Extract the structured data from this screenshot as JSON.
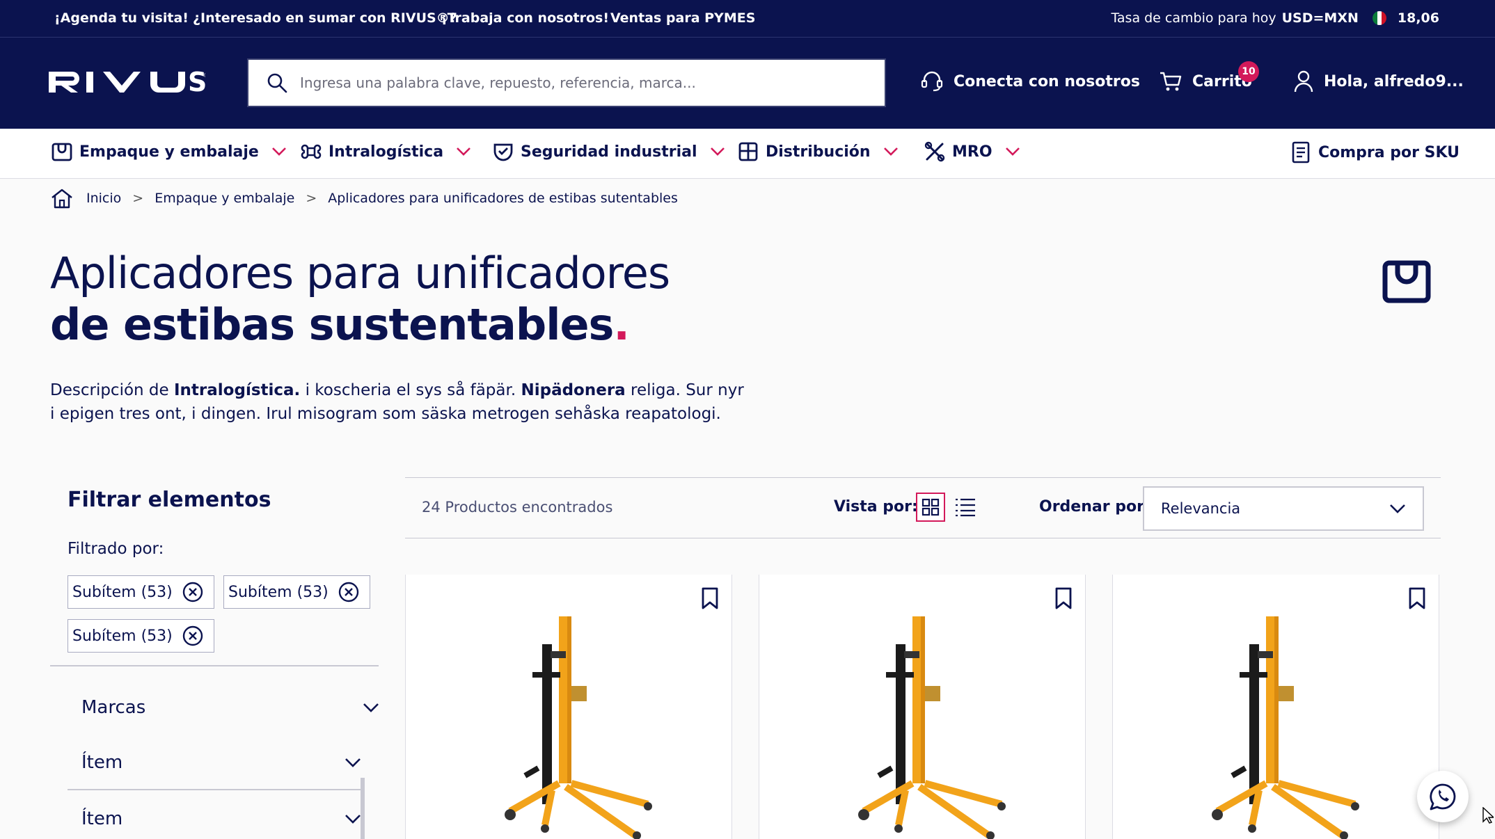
{
  "topbar": {
    "links": [
      "¡Agenda tu visita!",
      "¿Interesado en sumar con RIVUS®?",
      "¡Trabaja con nosotros!",
      "Ventas para PYMES"
    ],
    "rate_label": "Tasa de cambio para hoy",
    "rate_pair": "USD=MXN",
    "rate_value": "18,06"
  },
  "header": {
    "logo_text": "RIVUS",
    "search_placeholder": "Ingresa una palabra clave, repuesto, referencia, marca...",
    "contact_label": "Conecta con nosotros",
    "cart_label": "Carrito",
    "cart_count": "10",
    "user_label": "Hola, alfredo9..."
  },
  "catnav": {
    "items": [
      "Empaque y embalaje",
      "Intralogística",
      "Seguridad industrial",
      "Distribución",
      "MRO"
    ],
    "sku_label": "Compra por SKU"
  },
  "breadcrumb": [
    "Inicio",
    "Empaque y embalaje",
    "Aplicadores para unificadores de estibas sutentables"
  ],
  "page": {
    "title_line1": "Aplicadores para unificadores",
    "title_line2": "de estibas sustentables",
    "title_dot": ".",
    "desc_p1": "Descripción de ",
    "desc_b1": "Intralogística.",
    "desc_p2": " i koscheria el sys så fäpär. ",
    "desc_b2": "Nipädonera",
    "desc_p3": " religa. Sur nyr i epigen tres ont, i dingen. Irul misogram som säska metrogen sehåska reapatologi."
  },
  "filters": {
    "title": "Filtrar elementos",
    "filtered_by": "Filtrado por:",
    "chips": [
      "Subítem (53)",
      "Subítem (53)",
      "Subítem (53)"
    ],
    "accordions": [
      "Marcas",
      "Ítem",
      "Ítem"
    ]
  },
  "toolbar": {
    "count": "24 Productos encontrados",
    "view_label": "Vista  por:",
    "sort_label": "Ordenar por:",
    "sort_value": "Relevancia"
  },
  "products": [
    {
      "image": "drum-lifter-yellow"
    },
    {
      "image": "drum-lifter-yellow"
    },
    {
      "image": "drum-lifter-yellow"
    }
  ],
  "colors": {
    "navy": "#0b134f",
    "accent": "#d3195a"
  }
}
